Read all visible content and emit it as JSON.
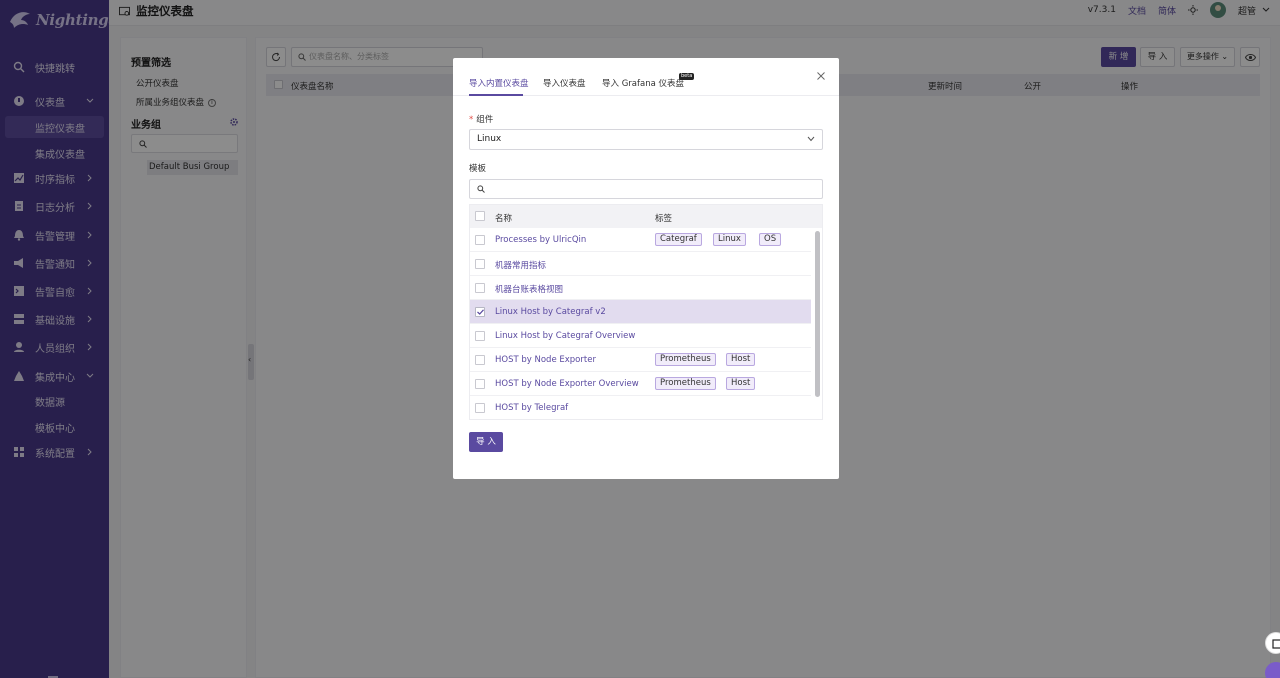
{
  "app": {
    "logo_text": "Nightingale"
  },
  "header": {
    "page_title": "监控仪表盘",
    "version": "v7.3.1",
    "docs_link": "文档",
    "language": "简体",
    "username": "超管"
  },
  "sidebar": {
    "items": [
      {
        "label": "快捷跳转",
        "icon": "search-icon"
      },
      {
        "label": "仪表盘",
        "icon": "dashboard-icon",
        "expanded": true
      },
      {
        "label": "监控仪表盘",
        "sub": true,
        "active": true
      },
      {
        "label": "集成仪表盘",
        "sub": true
      },
      {
        "label": "时序指标",
        "icon": "chart-icon"
      },
      {
        "label": "日志分析",
        "icon": "log-icon"
      },
      {
        "label": "告警管理",
        "icon": "alert-icon"
      },
      {
        "label": "告警通知",
        "icon": "notify-icon"
      },
      {
        "label": "告警自愈",
        "icon": "heal-icon"
      },
      {
        "label": "基础设施",
        "icon": "infra-icon"
      },
      {
        "label": "人员组织",
        "icon": "user-icon"
      },
      {
        "label": "集成中心",
        "icon": "integration-icon",
        "expanded": true
      },
      {
        "label": "数据源",
        "sub": true
      },
      {
        "label": "模板中心",
        "sub": true
      },
      {
        "label": "系统配置",
        "icon": "settings-icon"
      }
    ]
  },
  "filter": {
    "title": "预置筛选",
    "public_dashboards": "公开仪表盘",
    "group_dashboards": "所属业务组仪表盘",
    "busi_group_title": "业务组",
    "busi_groups": [
      "Default Busi Group"
    ]
  },
  "list": {
    "search_placeholder": "仪表盘名称、分类标签",
    "new_button": "新 增",
    "import_button": "导 入",
    "more_button": "更多操作",
    "columns": [
      "仪表盘名称",
      "更新时间",
      "公开",
      "操作"
    ]
  },
  "modal": {
    "tabs": [
      {
        "label": "导入内置仪表盘",
        "active": true
      },
      {
        "label": "导入仪表盘"
      },
      {
        "label": "导入 Grafana 仪表盘",
        "badge": "beta"
      }
    ],
    "component_label": "组件",
    "component_value": "Linux",
    "template_label": "模板",
    "template_search_placeholder": "",
    "columns": {
      "name": "名称",
      "tags": "标签"
    },
    "rows": [
      {
        "name": "Processes by UlricQin",
        "tags": [
          "Categraf",
          "Linux",
          "OS"
        ],
        "checked": false
      },
      {
        "name": "机器常用指标",
        "tags": [],
        "checked": false
      },
      {
        "name": "机器台账表格视图",
        "tags": [],
        "checked": false
      },
      {
        "name": "Linux Host by Categraf v2",
        "tags": [],
        "checked": true
      },
      {
        "name": "Linux Host by Categraf Overview",
        "tags": [],
        "checked": false
      },
      {
        "name": "HOST by Node Exporter",
        "tags": [
          "Prometheus",
          "Host"
        ],
        "checked": false
      },
      {
        "name": "HOST by Node Exporter Overview",
        "tags": [
          "Prometheus",
          "Host"
        ],
        "checked": false
      },
      {
        "name": "HOST by Telegraf",
        "tags": [],
        "checked": false
      }
    ],
    "import_button": "导 入"
  },
  "colors": {
    "primary": "#5a4aa0",
    "sidebar": "#4a3a8a"
  }
}
